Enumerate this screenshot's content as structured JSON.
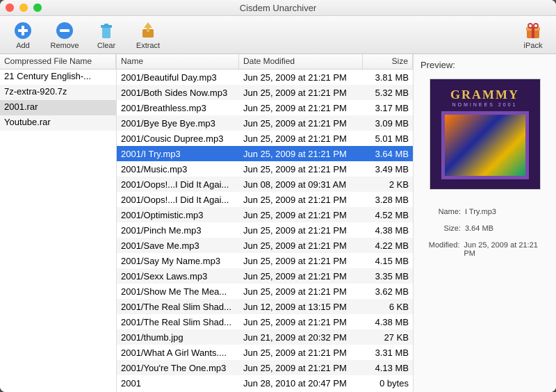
{
  "window": {
    "title": "Cisdem Unarchiver"
  },
  "toolbar": {
    "add": "Add",
    "remove": "Remove",
    "clear": "Clear",
    "extract": "Extract",
    "ipack": "iPack"
  },
  "columns": {
    "arch": "Compressed File Name",
    "name": "Name",
    "date": "Date Modified",
    "size": "Size"
  },
  "archives": [
    {
      "name": "21 Century English-...",
      "selected": false
    },
    {
      "name": "7z-extra-920.7z",
      "selected": false
    },
    {
      "name": "2001.rar",
      "selected": true
    },
    {
      "name": "Youtube.rar",
      "selected": false
    }
  ],
  "files": [
    {
      "name": "2001/Beautiful Day.mp3",
      "date": "Jun 25, 2009 at 21:21 PM",
      "size": "3.81 MB",
      "selected": false
    },
    {
      "name": "2001/Both Sides Now.mp3",
      "date": "Jun 25, 2009 at 21:21 PM",
      "size": "5.32 MB",
      "selected": false
    },
    {
      "name": "2001/Breathless.mp3",
      "date": "Jun 25, 2009 at 21:21 PM",
      "size": "3.17 MB",
      "selected": false
    },
    {
      "name": "2001/Bye Bye Bye.mp3",
      "date": "Jun 25, 2009 at 21:21 PM",
      "size": "3.09 MB",
      "selected": false
    },
    {
      "name": "2001/Cousic Dupree.mp3",
      "date": "Jun 25, 2009 at 21:21 PM",
      "size": "5.01 MB",
      "selected": false
    },
    {
      "name": "2001/I Try.mp3",
      "date": "Jun 25, 2009 at 21:21 PM",
      "size": "3.64 MB",
      "selected": true
    },
    {
      "name": "2001/Music.mp3",
      "date": "Jun 25, 2009 at 21:21 PM",
      "size": "3.49 MB",
      "selected": false
    },
    {
      "name": "2001/Oops!...I Did It Agai...",
      "date": "Jun 08, 2009 at 09:31 AM",
      "size": "2 KB",
      "selected": false
    },
    {
      "name": "2001/Oops!...I Did It Agai...",
      "date": "Jun 25, 2009 at 21:21 PM",
      "size": "3.28 MB",
      "selected": false
    },
    {
      "name": "2001/Optimistic.mp3",
      "date": "Jun 25, 2009 at 21:21 PM",
      "size": "4.52 MB",
      "selected": false
    },
    {
      "name": "2001/Pinch Me.mp3",
      "date": "Jun 25, 2009 at 21:21 PM",
      "size": "4.38 MB",
      "selected": false
    },
    {
      "name": "2001/Save Me.mp3",
      "date": "Jun 25, 2009 at 21:21 PM",
      "size": "4.22 MB",
      "selected": false
    },
    {
      "name": "2001/Say My Name.mp3",
      "date": "Jun 25, 2009 at 21:21 PM",
      "size": "4.15 MB",
      "selected": false
    },
    {
      "name": "2001/Sexx Laws.mp3",
      "date": "Jun 25, 2009 at 21:21 PM",
      "size": "3.35 MB",
      "selected": false
    },
    {
      "name": "2001/Show Me The Mea...",
      "date": "Jun 25, 2009 at 21:21 PM",
      "size": "3.62 MB",
      "selected": false
    },
    {
      "name": "2001/The Real Slim Shad...",
      "date": "Jun 12, 2009 at 13:15 PM",
      "size": "6 KB",
      "selected": false
    },
    {
      "name": "2001/The Real Slim Shad...",
      "date": "Jun 25, 2009 at 21:21 PM",
      "size": "4.38 MB",
      "selected": false
    },
    {
      "name": "2001/thumb.jpg",
      "date": "Jun 21, 2009 at 20:32 PM",
      "size": "27 KB",
      "selected": false
    },
    {
      "name": "2001/What A Girl Wants....",
      "date": "Jun 25, 2009 at 21:21 PM",
      "size": "3.31 MB",
      "selected": false
    },
    {
      "name": "2001/You're The One.mp3",
      "date": "Jun 25, 2009 at 21:21 PM",
      "size": "4.13 MB",
      "selected": false
    },
    {
      "name": "2001",
      "date": "Jun 28, 2010 at 20:47 PM",
      "size": "0 bytes",
      "selected": false
    }
  ],
  "preview": {
    "heading": "Preview:",
    "cover_title": "GRAMMY",
    "cover_sub": "NOMINEES 2001",
    "name_label": "Name:",
    "name_value": "I Try.mp3",
    "size_label": "Size:",
    "size_value": "3.64 MB",
    "mod_label": "Modified:",
    "mod_value": "Jun 25, 2009 at 21:21 PM"
  }
}
